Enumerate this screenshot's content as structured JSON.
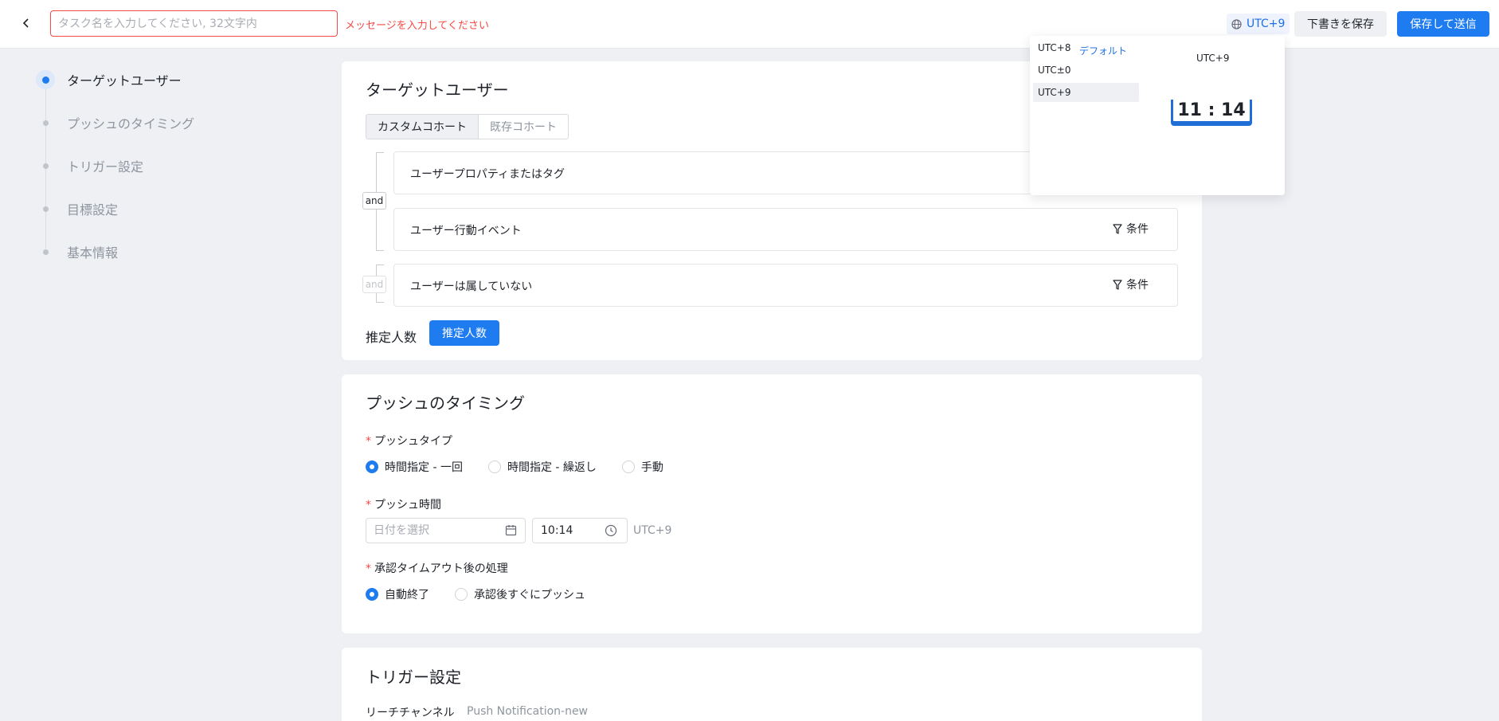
{
  "header": {
    "task_placeholder": "タスク名を入力してください, 32文字内",
    "task_error": "メッセージを入力してください",
    "timezone_label": "UTC+9",
    "save_draft_label": "下書きを保存",
    "save_send_label": "保存して送信"
  },
  "steps": [
    {
      "label": "ターゲットユーザー",
      "active": true
    },
    {
      "label": "プッシュのタイミング",
      "active": false
    },
    {
      "label": "トリガー設定",
      "active": false
    },
    {
      "label": "目標設定",
      "active": false
    },
    {
      "label": "基本情報",
      "active": false
    }
  ],
  "target": {
    "title": "ターゲットユーザー",
    "tabs": [
      "カスタムコホート",
      "既存コホート"
    ],
    "conditions": [
      {
        "label": "ユーザープロパティまたはタグ"
      },
      {
        "label": "ユーザー行動イベント",
        "filter_label": "条件"
      },
      {
        "label": "ユーザーは属していない",
        "filter_label": "条件"
      }
    ],
    "and_label": "and",
    "estimate_label": "推定人数",
    "estimate_button": "推定人数"
  },
  "timing": {
    "title": "プッシュのタイミング",
    "push_type_label": "プッシュタイプ",
    "push_types": [
      "時間指定 - 一回",
      "時間指定 - 繰返し",
      "手動"
    ],
    "push_time_label": "プッシュ時間",
    "date_placeholder": "日付を選択",
    "time_value": "10:14",
    "timezone": "UTC+9",
    "timeout_label": "承認タイムアウト後の処理",
    "timeout_options": [
      "自動終了",
      "承認後すぐにプッシュ"
    ]
  },
  "trigger": {
    "title": "トリガー設定",
    "channel_label": "リーチチャンネル",
    "channel_value": "Push Notification-new"
  },
  "tz_popover": {
    "options": [
      "UTC+8",
      "UTC±0",
      "UTC+9"
    ],
    "selected": "UTC+9",
    "default_label": "デフォルト",
    "preview_label": "UTC+9",
    "clock_time": "11 : 14"
  },
  "colors": {
    "primary": "#1f7cf0",
    "error": "#f54a45",
    "background": "#eef0f4"
  }
}
